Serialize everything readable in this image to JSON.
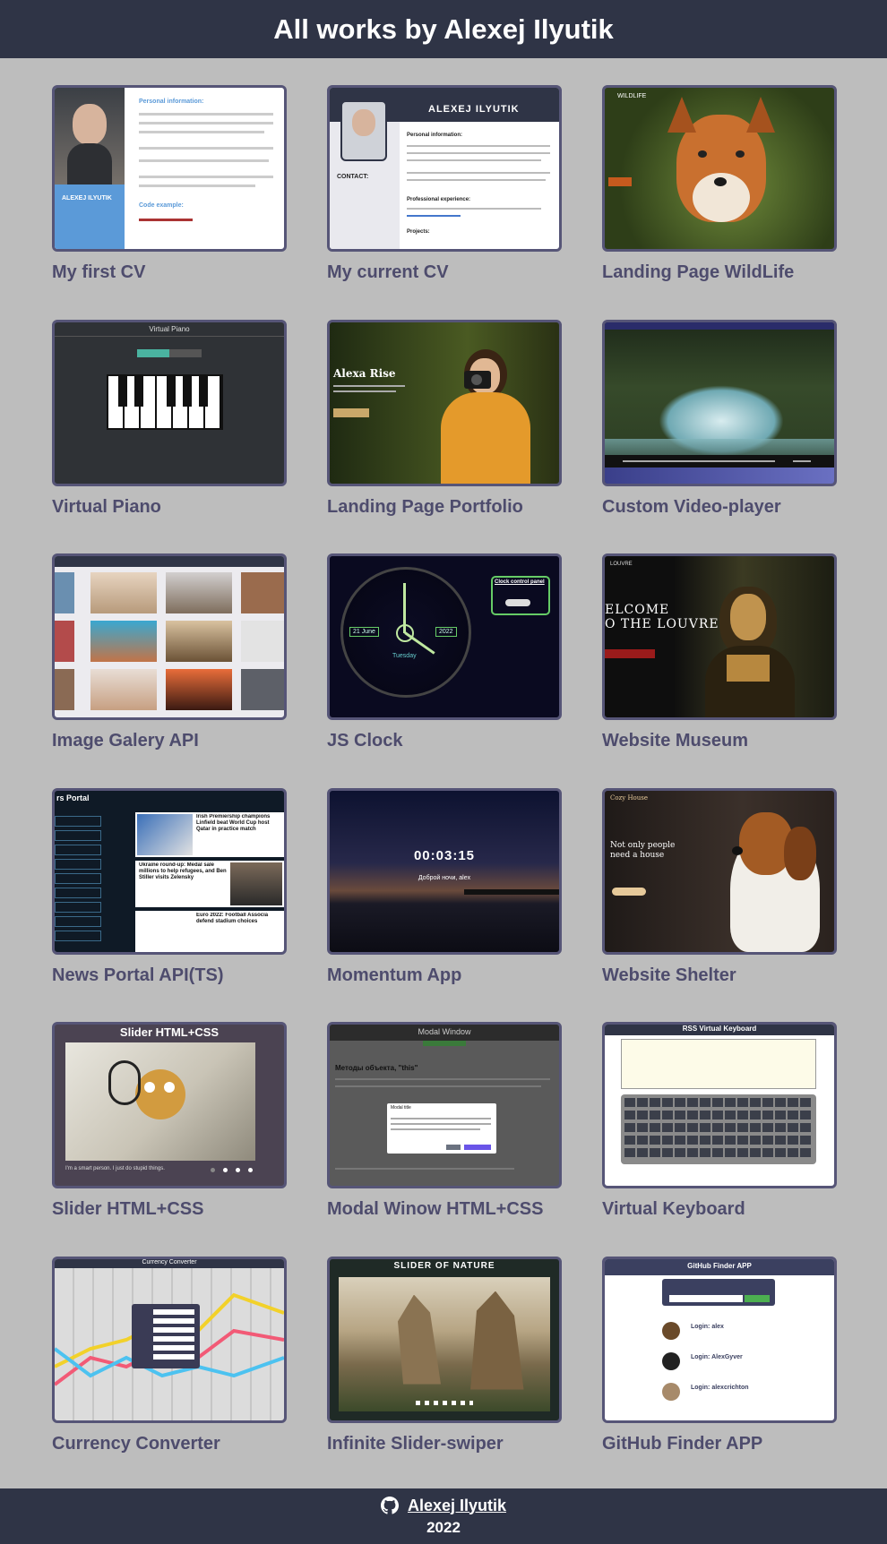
{
  "header": {
    "title": "All works by Alexej Ilyutik"
  },
  "works": [
    {
      "title": "My first CV"
    },
    {
      "title": "My current CV"
    },
    {
      "title": "Landing Page WildLife"
    },
    {
      "title": "Virtual Piano"
    },
    {
      "title": "Landing Page Portfolio"
    },
    {
      "title": "Custom Video-player"
    },
    {
      "title": "Image Galery API"
    },
    {
      "title": "JS Clock"
    },
    {
      "title": "Website Museum"
    },
    {
      "title": "News Portal API(TS)"
    },
    {
      "title": "Momentum App"
    },
    {
      "title": "Website Shelter"
    },
    {
      "title": "Slider HTML+CSS"
    },
    {
      "title": "Modal Winow HTML+CSS"
    },
    {
      "title": "Virtual Keyboard"
    },
    {
      "title": "Currency Converter"
    },
    {
      "title": "Infinite Slider-swiper"
    },
    {
      "title": "GitHub Finder APP"
    }
  ],
  "thumbs": {
    "cv1": {
      "section": "Personal information:",
      "name": "ALEXEJ ILYUTIK",
      "code": "Code example:"
    },
    "cv2": {
      "name": "ALEXEJ ILYUTIK",
      "contact": "CONTACT:",
      "personal": "Personal information:",
      "experience": "Professional experience:",
      "projects": "Projects:"
    },
    "wild": {
      "brand": "WILDLIFE"
    },
    "piano": {
      "title": "Virtual Piano"
    },
    "portfolio": {
      "name": "Alexa Rise"
    },
    "clock": {
      "panel": "Clock control panel",
      "date": "21 June",
      "year": "2022",
      "day": "Tuesday"
    },
    "museum": {
      "brand": "LOUVRE",
      "headline1": "ELCOME",
      "headline2": "O THE LOUVRE"
    },
    "news": {
      "title": "rs Portal",
      "h1": "Irish Premiership champions Linfield beat World Cup host Qatar in practice match",
      "h2": "Ukraine round-up: Medal sale millions to help refugees, and Ben Stiller visits Zelensky",
      "h3": "Euro 2022: Football Associa defend stadium choices"
    },
    "momentum": {
      "time": "00:03:15",
      "greeting": "Доброй ночи, alex"
    },
    "shelter": {
      "brand": "Cozy House",
      "headline": "Not only people need a house"
    },
    "slider": {
      "title": "Slider HTML+CSS",
      "caption": "I'm a smart person. I just do stupid things."
    },
    "modal": {
      "title": "Modal Window",
      "heading": "Методы объекта, \"this\"",
      "box": "Modal title"
    },
    "keyboard": {
      "title": "RSS Virtual Keyboard"
    },
    "currency": {
      "title": "Currency Converter"
    },
    "swiper": {
      "title": "SLIDER OF NATURE"
    },
    "github": {
      "title": "GitHub Finder APP",
      "user1": "Login: alex",
      "user2": "Login: AlexGyver",
      "user3": "Login: alexcrichton"
    }
  },
  "footer": {
    "author": "Alexej Ilyutik",
    "year": "2022",
    "icon": "github-icon"
  }
}
